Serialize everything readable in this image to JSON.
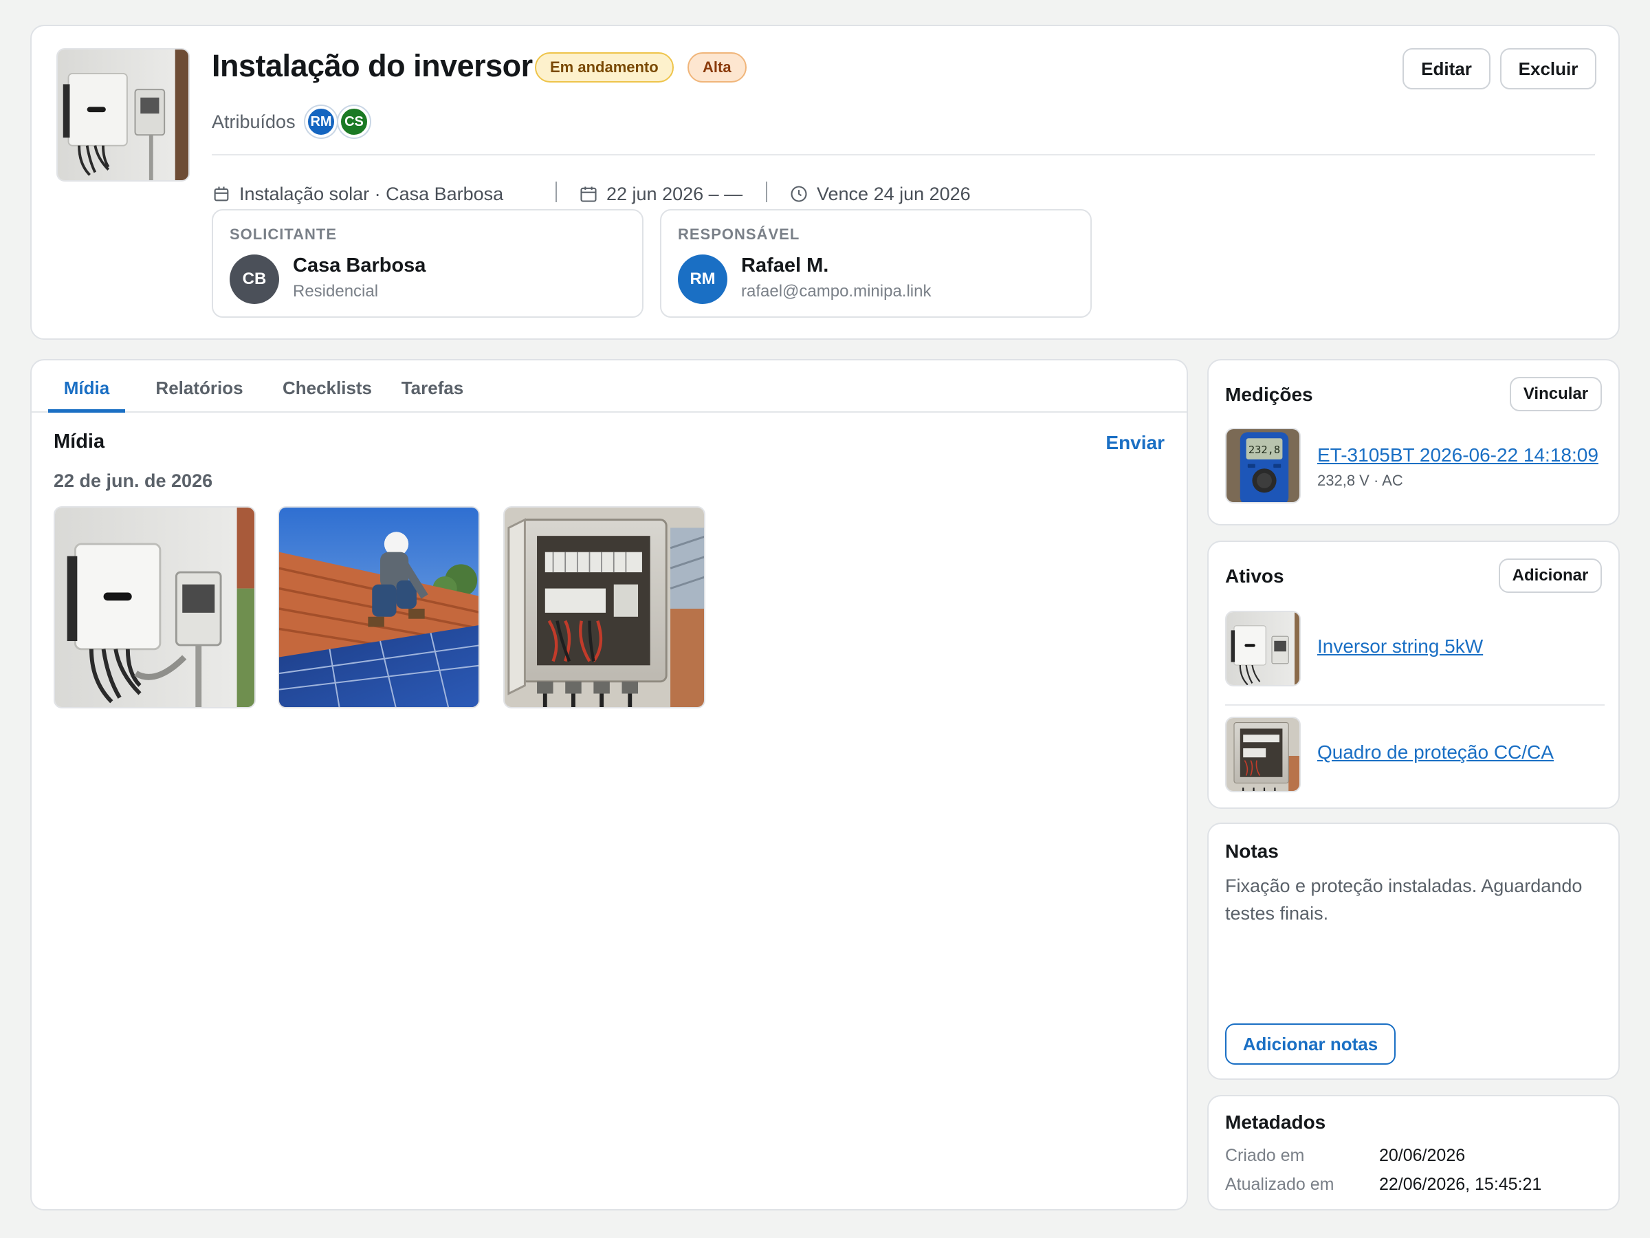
{
  "header": {
    "title": "Instalação do inversor",
    "status_badge": "Em andamento",
    "priority_badge": "Alta",
    "assigned_label": "Atribuídos",
    "assignees": [
      {
        "initials": "RM",
        "color": "#1565c0"
      },
      {
        "initials": "CS",
        "color": "#1b7a24"
      }
    ],
    "edit_label": "Editar",
    "delete_label": "Excluir",
    "meta": {
      "project": "Instalação solar · Casa Barbosa",
      "dates": "22 jun 2026 – —",
      "due": "Vence 24 jun 2026"
    },
    "requester": {
      "label": "SOLICITANTE",
      "initials": "CB",
      "name": "Casa Barbosa",
      "sub": "Residencial",
      "avatar_color": "#4b5059"
    },
    "responsible": {
      "label": "RESPONSÁVEL",
      "initials": "RM",
      "name": "Rafael M.",
      "sub": "rafael@campo.minipa.link",
      "avatar_color": "#1a6fc4"
    }
  },
  "tabs": [
    {
      "label": "Mídia",
      "active": true
    },
    {
      "label": "Relatórios",
      "active": false
    },
    {
      "label": "Checklists",
      "active": false
    },
    {
      "label": "Tarefas",
      "active": false
    }
  ],
  "media": {
    "heading": "Mídia",
    "upload_label": "Enviar",
    "date_group": "22 de jun. de 2026",
    "items": [
      "inverter-photo",
      "roof-worker-photo",
      "electrical-panel-photo"
    ]
  },
  "measurements": {
    "title": "Medições",
    "link_label": "Vincular",
    "items": [
      {
        "name": "ET-3105BT 2026-06-22 14:18:09",
        "detail": "232,8 V · AC",
        "display": "232,8"
      }
    ]
  },
  "assets": {
    "title": "Ativos",
    "add_label": "Adicionar",
    "items": [
      {
        "name": "Inversor string 5kW"
      },
      {
        "name": "Quadro de proteção CC/CA"
      }
    ]
  },
  "notes": {
    "title": "Notas",
    "text": "Fixação e proteção instaladas. Aguardando testes finais.",
    "add_label": "Adicionar notas"
  },
  "metadata": {
    "title": "Metadados",
    "created_label": "Criado em",
    "created_value": "20/06/2026",
    "updated_label": "Atualizado em",
    "updated_value": "22/06/2026, 15:45:21"
  },
  "colors": {
    "accent": "#1a6fc4",
    "status_bg": "#fdf1cc",
    "priority_bg": "#fde6d0"
  }
}
